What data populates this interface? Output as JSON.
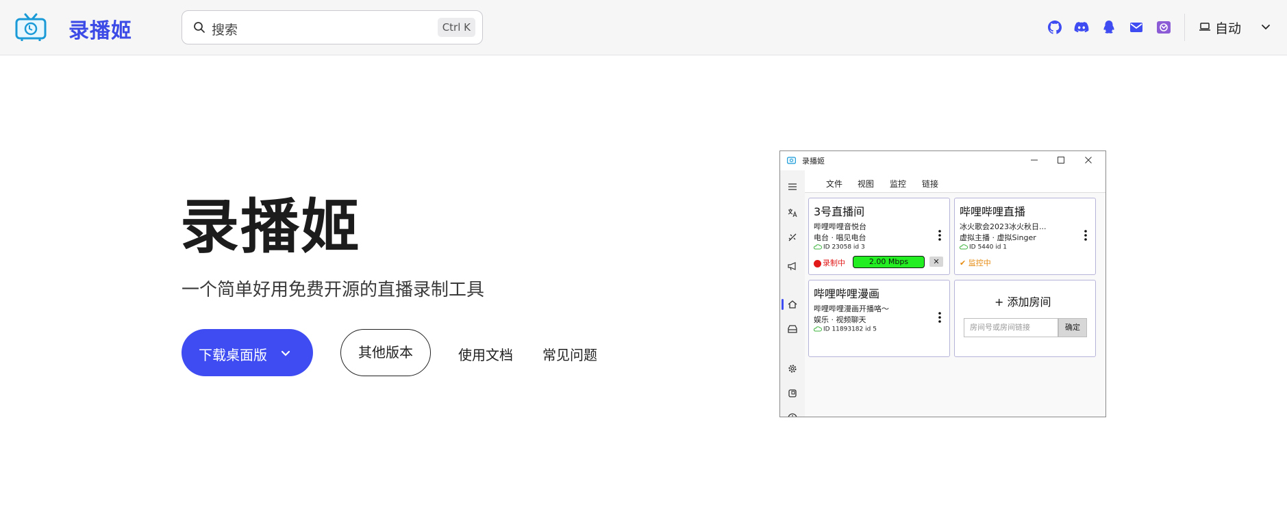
{
  "nav": {
    "brand": "录播姬",
    "search_placeholder": "搜索",
    "search_shortcut": "Ctrl K",
    "icons": [
      "github-icon",
      "discord-icon",
      "qq-icon",
      "mail-icon",
      "misskey-icon"
    ],
    "theme_label": "自动",
    "accent_color": "#3e4cf2"
  },
  "hero": {
    "title": "录播姬",
    "subtitle": "一个简单好用免费开源的直播录制工具",
    "primary_button": "下载桌面版",
    "secondary_button": "其他版本",
    "link_docs": "使用文档",
    "link_faq": "常见问题"
  },
  "app": {
    "window_title": "录播姬",
    "menu": [
      "文件",
      "视图",
      "监控",
      "链接"
    ],
    "rooms": [
      {
        "title": "3号直播间",
        "line1": "哔哩哔哩音悦台",
        "line2": "电台 · 唱见电台",
        "id_text": "ID 23058  id 3",
        "status": "录制中",
        "speed": "2.00 Mbps"
      },
      {
        "title": "哔哩哔哩直播",
        "line1": "冰火歌会2023冰火秋日...",
        "line2": "虚拟主播 · 虚拟Singer",
        "id_text": "ID 5440  id 1",
        "status": "监控中"
      },
      {
        "title": "哔哩哔哩漫画",
        "line1": "哔哩哔哩漫画开播咯～",
        "line2": "娱乐 · 视频聊天",
        "id_text": "ID 11893182  id 5"
      }
    ],
    "add_room": {
      "title": "+ 添加房间",
      "placeholder": "房间号或房间链接",
      "confirm": "确定"
    }
  }
}
